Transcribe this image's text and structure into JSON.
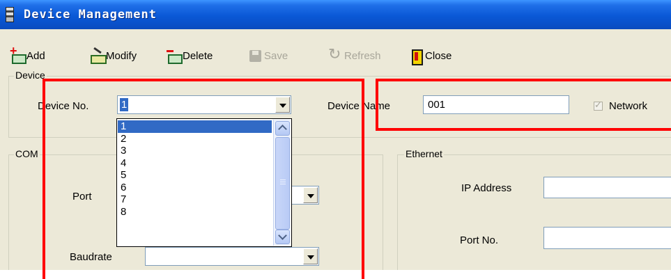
{
  "window": {
    "title": "Device Management"
  },
  "toolbar": {
    "add_label": "Add",
    "modify_label": "Modify",
    "delete_label": "Delete",
    "save_label": "Save",
    "refresh_label": "Refresh",
    "close_label": "Close"
  },
  "device_group": {
    "label": "Device",
    "device_no_label": "Device No.",
    "device_no_value": "1",
    "device_name_label": "Device Name",
    "device_name_value": "001",
    "network_label": "Network",
    "network_checked": true
  },
  "device_no_dropdown": {
    "options": [
      "1",
      "2",
      "3",
      "4",
      "5",
      "6",
      "7",
      "8"
    ],
    "selected": "1"
  },
  "com_group": {
    "label": "COM",
    "port_label": "Port",
    "port_value": "",
    "baudrate_label": "Baudrate",
    "baudrate_value": ""
  },
  "ethernet_group": {
    "label": "Ethernet",
    "ip_label": "IP Address",
    "ip_value": "",
    "port_no_label": "Port No.",
    "port_no_value": ""
  },
  "colors": {
    "annotation": "#ff0000",
    "selection": "#316ac5",
    "titlebar": "#0a58d6"
  }
}
